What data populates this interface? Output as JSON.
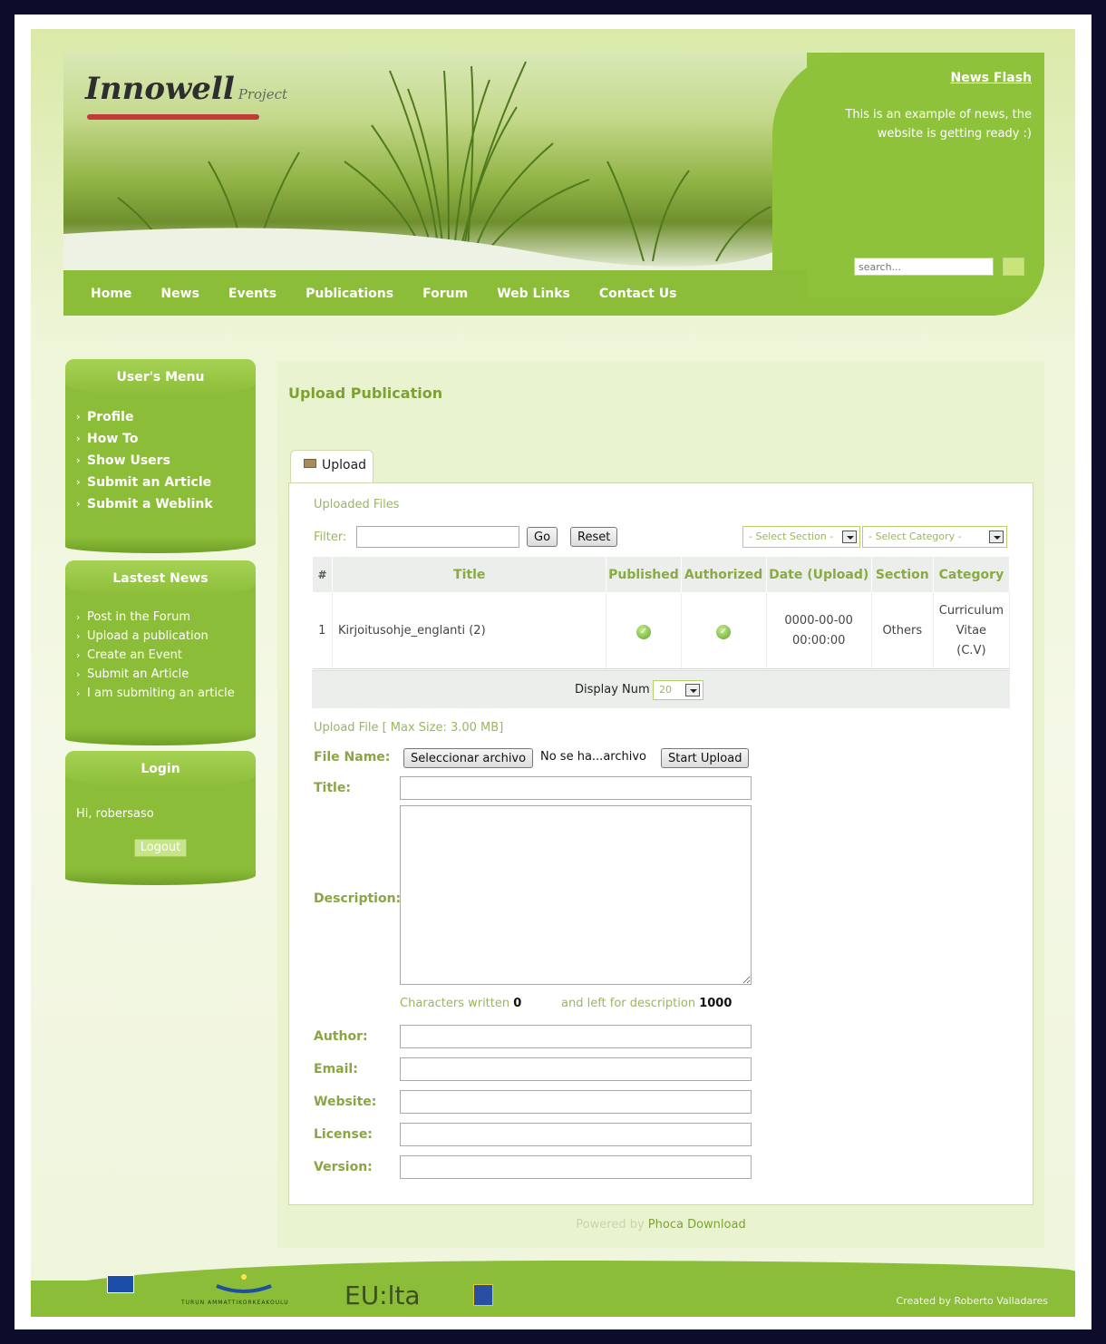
{
  "header": {
    "logo": "Innowell",
    "logo_sub": "Project",
    "news_flash_title": "News Flash",
    "news_flash_text": "This is an example of news, the website is getting ready :)",
    "search_placeholder": "search...",
    "nav": [
      "Home",
      "News",
      "Events",
      "Publications",
      "Forum",
      "Web Links",
      "Contact Us"
    ]
  },
  "users_menu": {
    "title": "User's Menu",
    "items": [
      "Profile",
      "How To",
      "Show Users",
      "Submit an Article",
      "Submit a Weblink"
    ]
  },
  "latest_news": {
    "title": "Lastest News",
    "items": [
      "Post in the Forum",
      "Upload a publication",
      "Create an Event",
      "Submit an Article",
      "I am submiting an article"
    ]
  },
  "login": {
    "title": "Login",
    "greeting": "Hi, robersaso",
    "logout": "Logout"
  },
  "main": {
    "title": "Upload Publication",
    "tab": "Upload",
    "uploaded_files": "Uploaded Files",
    "filter_label": "Filter:",
    "go": "Go",
    "reset": "Reset",
    "select_section": "- Select Section -",
    "select_category": "- Select Category -",
    "columns": [
      "#",
      "Title",
      "Published",
      "Authorized",
      "Date (Upload)",
      "Section",
      "Category"
    ],
    "row": {
      "num": "1",
      "title": "Kirjoitusohje_englanti (2)",
      "date_line1": "0000-00-00",
      "date_line2": "00:00:00",
      "section": "Others",
      "category_line1": "Curriculum",
      "category_line2": "Vitae",
      "category_line3": "(C.V)"
    },
    "display_num_label": "Display Num",
    "display_num_value": "20",
    "upload_label": "Upload File [ Max Size: 3.00 MB]",
    "file_name_label": "File Name:",
    "choose_file": "Seleccionar archivo",
    "no_file": "No se ha...archivo",
    "start_upload": "Start Upload",
    "title_label": "Title:",
    "description_label": "Description:",
    "chars_written_label": "Characters written",
    "chars_written_value": "0",
    "chars_left_label": "and left for description",
    "chars_left_value": "1000",
    "author_label": "Author:",
    "email_label": "Email:",
    "website_label": "Website:",
    "license_label": "License:",
    "version_label": "Version:",
    "powered_by": "Powered by",
    "powered_link": "Phoca Download"
  },
  "footer": {
    "eulta": "EU:lta",
    "turku": "TURUN AMMATTIKORKEAKOULU",
    "credit": "Created by Roberto Valladares"
  }
}
